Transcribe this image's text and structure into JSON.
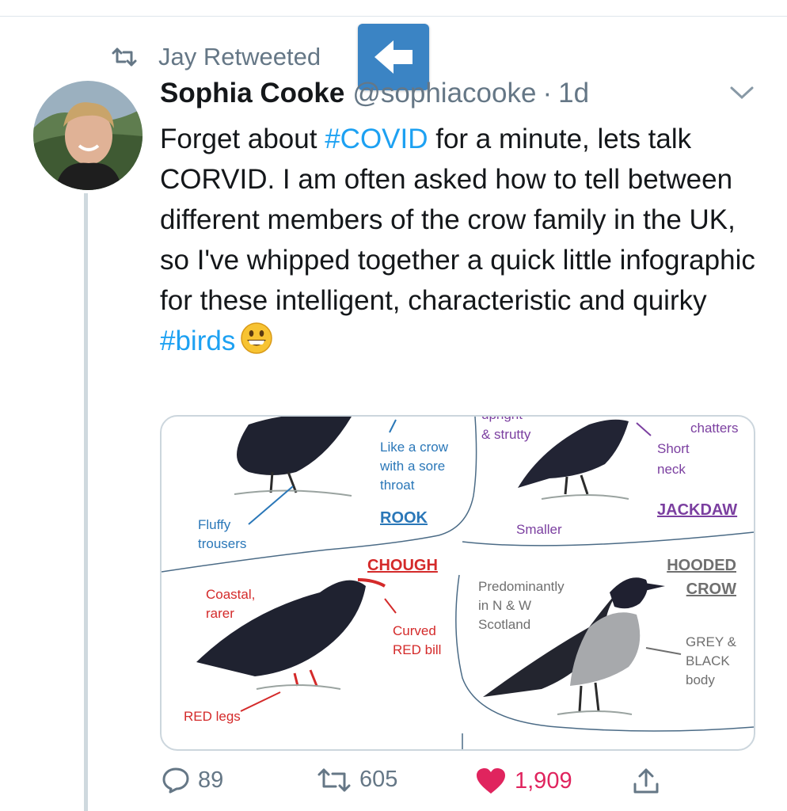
{
  "retweet": {
    "text": "Jay Retweeted",
    "icon": "retweet-icon"
  },
  "tweet": {
    "author_name": "Sophia Cooke",
    "author_handle": "@sophiacooke",
    "separator": "·",
    "time": "1d",
    "text_parts": [
      "Forget about ",
      "#COVID",
      " for a minute, lets talk CORVID. I am often asked how to tell between different members of the crow family in the UK, so I've whipped together a quick little infographic for these intelligent, characteristic and quirky ",
      "#birds"
    ],
    "emoji": "grinning-face-emoji"
  },
  "infographic": {
    "rook": {
      "title": "ROOK",
      "note1": "Like a crow",
      "note2": "with a sore",
      "note3": "throat",
      "trousers1": "Fluffy",
      "trousers2": "trousers"
    },
    "jackdaw": {
      "title": "JACKDAW",
      "upright_partial": "upright",
      "strutty": "& strutty",
      "chatters": "chatters",
      "neck1": "Short",
      "neck2": "neck",
      "smaller": "Smaller"
    },
    "chough": {
      "title": "CHOUGH",
      "coastal1": "Coastal,",
      "coastal2": "rarer",
      "bill1": "Curved",
      "bill2": "RED bill",
      "legs": "RED legs"
    },
    "hooded": {
      "title1": "HOODED",
      "title2": "CROW",
      "region1": "Predominantly",
      "region2": "in N & W",
      "region3": "Scotland",
      "body1": "GREY &",
      "body2": "BLACK",
      "body3": "body"
    },
    "colors": {
      "rook": "#2a77b8",
      "jackdaw": "#7b3fa0",
      "chough": "#d42a2a",
      "hooded": "#6f6f6f"
    }
  },
  "actions": {
    "replies": "89",
    "retweets": "605",
    "likes": "1,909",
    "like_color": "#e0245e",
    "icons": [
      "reply-icon",
      "retweet-icon",
      "heart-icon",
      "share-icon"
    ]
  }
}
